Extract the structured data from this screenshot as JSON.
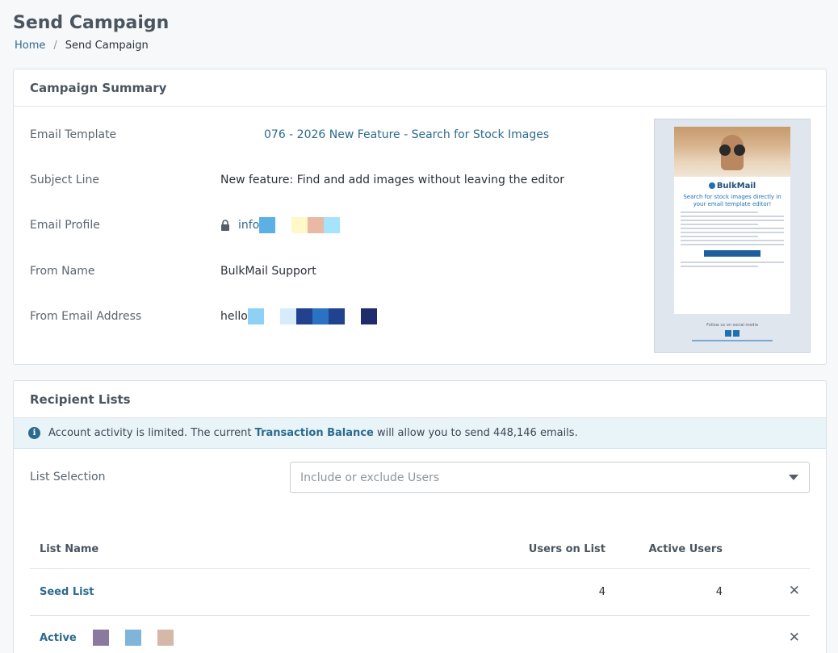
{
  "page": {
    "title": "Send Campaign",
    "breadcrumb": {
      "home": "Home",
      "separator": "/",
      "current": "Send Campaign"
    }
  },
  "summary": {
    "header": "Campaign Summary",
    "rows": {
      "template": {
        "label": "Email Template",
        "value": "076 - 2026 New Feature - Search for Stock Images"
      },
      "subject": {
        "label": "Subject Line",
        "value": "New feature: Find and add images without leaving the editor"
      },
      "profile": {
        "label": "Email Profile",
        "value": "info",
        "redaction_colors": [
          "#5bb0e6",
          "#ffffff",
          "#fff8c8",
          "#e8b9a4",
          "#a6e4fb"
        ]
      },
      "from_name": {
        "label": "From Name",
        "value": "BulkMail Support"
      },
      "from_email": {
        "label": "From Email Address",
        "value": "hello",
        "redaction_colors": [
          "#8fd0f5",
          "#ffffff",
          "#d6ecfa",
          "#22418f",
          "#2a73c3",
          "#21428f",
          "#ffffff",
          "#1f2b6d"
        ]
      }
    },
    "preview": {
      "logo": "BulkMail",
      "headline": "Search for stock images directly in your email template editor!",
      "cta": "",
      "footer": "Follow us on social media"
    }
  },
  "recipients": {
    "header": "Recipient Lists",
    "alert": {
      "icon": "info-icon",
      "text_before": "Account activity is limited. The current ",
      "strong": "Transaction Balance",
      "text_after": " will allow you to send 448,146 emails."
    },
    "list_selection": {
      "label": "List Selection",
      "placeholder": "Include or exclude Users"
    },
    "table": {
      "columns": [
        "List Name",
        "Users on List",
        "Active Users"
      ],
      "rows": [
        {
          "name": "Seed List",
          "users": "4",
          "active": "4",
          "remove_icon": "close-icon"
        },
        {
          "name": "Active",
          "users": "",
          "active": "",
          "remove_icon": "close-icon",
          "redaction_colors": [
            "#8a7aa0",
            "#7fb5da",
            "#d6b8a8"
          ]
        }
      ]
    }
  },
  "colors": {
    "accent": "#2d6a8e",
    "alert_bg": "#e8f4f8",
    "page_bg": "#f7f8fa"
  }
}
